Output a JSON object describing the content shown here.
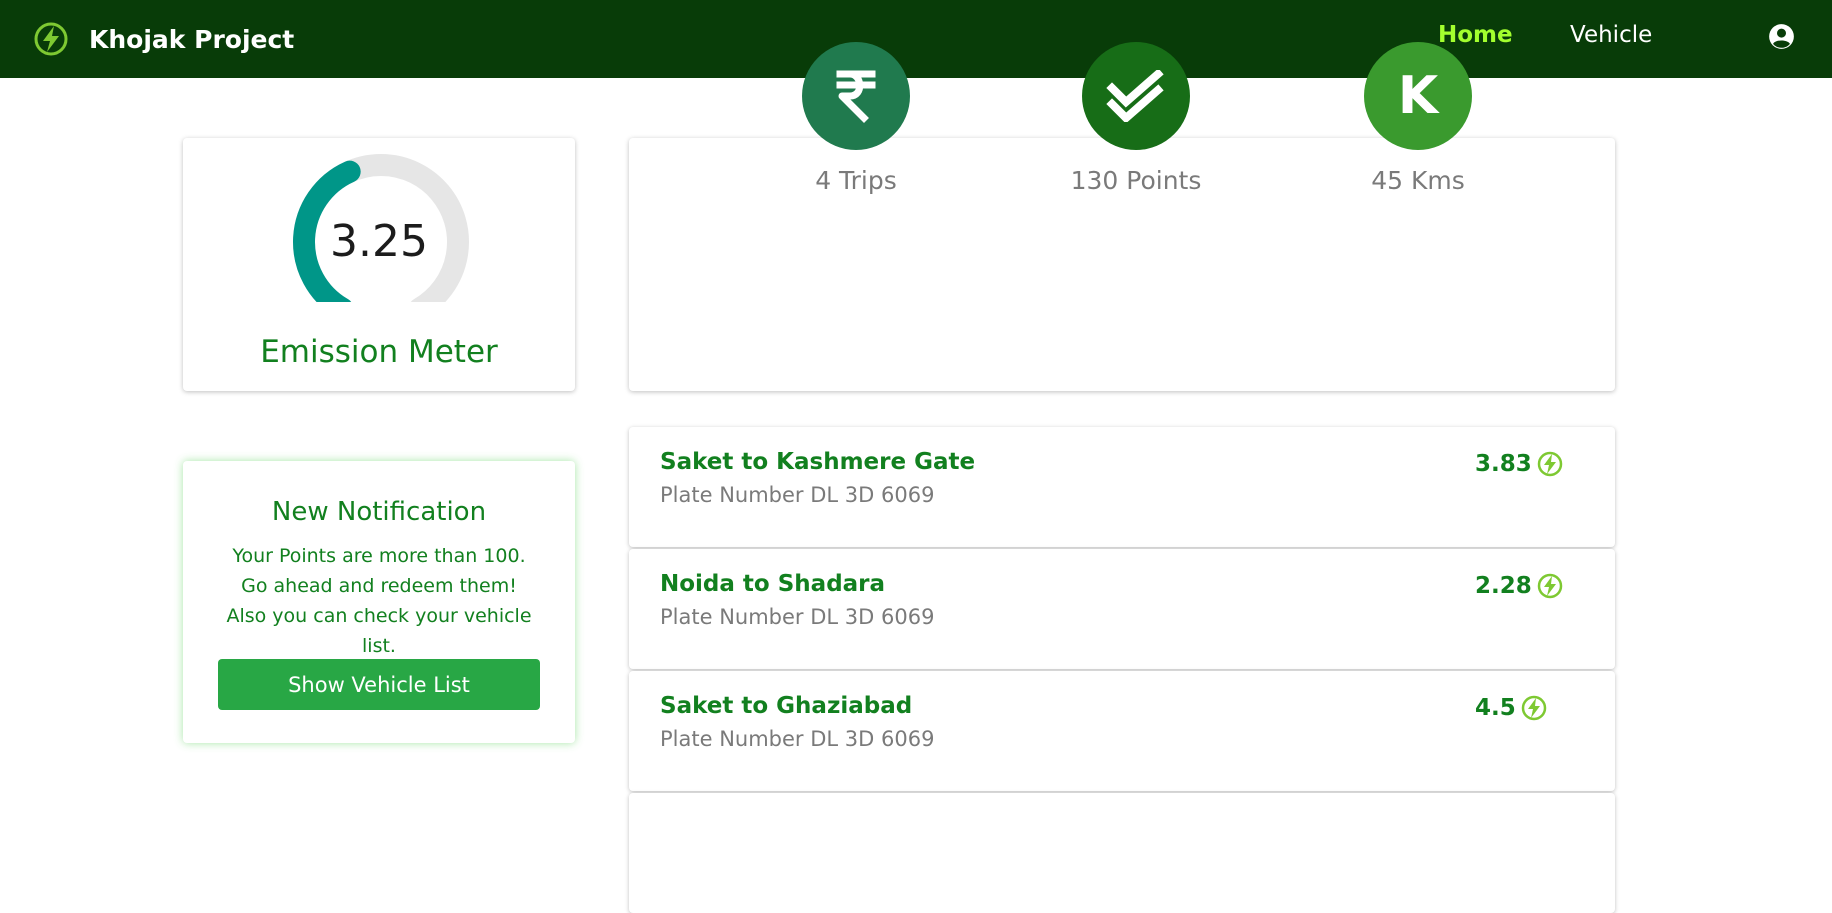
{
  "app": {
    "title": "Khojak Project"
  },
  "nav": {
    "home": "Home",
    "vehicle": "Vehicle"
  },
  "emission": {
    "value": "3.25",
    "title": "Emission Meter",
    "gauge_fraction": 0.42
  },
  "stats": [
    {
      "label": "4 Trips",
      "icon": "rupee-icon",
      "color": "#207a4e"
    },
    {
      "label": "130 Points",
      "icon": "check-double-icon",
      "color": "#176d17"
    },
    {
      "label": "45 Kms",
      "icon": "k-letter-icon",
      "letter": "K",
      "color": "#3a9a2e"
    }
  ],
  "notification": {
    "title": "New Notification",
    "text": "Your Points are more than 100. Go ahead and redeem them! Also you can check your vehicle list.",
    "button": "Show Vehicle List"
  },
  "trips": [
    {
      "route": "Saket to Kashmere Gate",
      "plate": "Plate Number DL 3D 6069",
      "score": "3.83"
    },
    {
      "route": "Noida to Shadara",
      "plate": "Plate Number DL 3D 6069",
      "score": "2.28"
    },
    {
      "route": "Saket to Ghaziabad",
      "plate": "Plate Number DL 3D 6069",
      "score": "4.5"
    }
  ],
  "colors": {
    "navbar": "#083c08",
    "accent": "#a3ff2e",
    "gauge": "#009688",
    "primary_green": "#12801f",
    "button": "#28a745"
  }
}
